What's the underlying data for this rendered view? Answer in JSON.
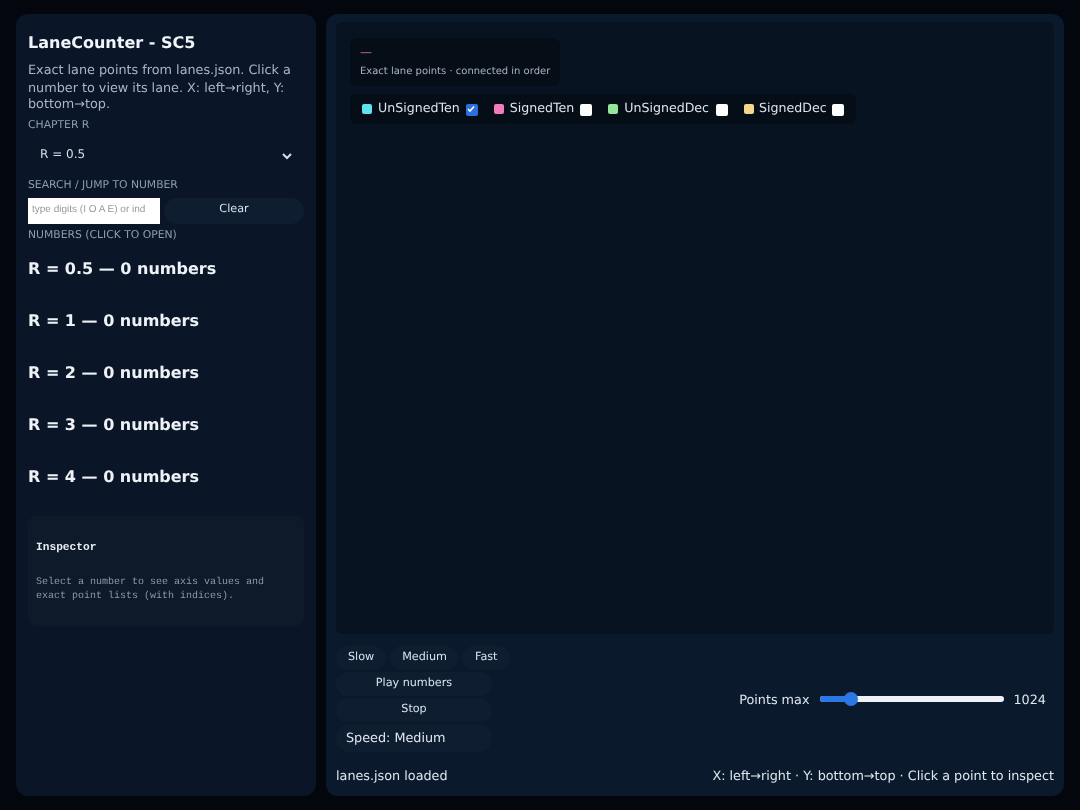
{
  "sidebar": {
    "title": "LaneCounter - SC5",
    "description": "Exact lane points from lanes.json. Click a number to view its lane. X: left→right, Y: bottom→top.",
    "chapter_label": "CHAPTER R",
    "chapter_value": "R = 0.5",
    "search_label": "SEARCH / JUMP TO NUMBER",
    "search_placeholder": "type digits (I O A E) or ind",
    "clear_button": "Clear",
    "numbers_label": "NUMBERS (CLICK TO OPEN)",
    "groups": [
      "R = 0.5 — 0 numbers",
      "R = 1 — 0 numbers",
      "R = 2 — 0 numbers",
      "R = 3 — 0 numbers",
      "R = 4 — 0 numbers"
    ],
    "inspector": {
      "title": "Inspector",
      "text": "Select a number to see axis values and exact point lists (with indices)."
    }
  },
  "chart": {
    "title": "—",
    "subtitle": "Exact lane points · connected in order",
    "legend": [
      {
        "label": "UnSignedTen",
        "color": "#5fe3f0",
        "checked": true
      },
      {
        "label": "SignedTen",
        "color": "#f27bbd",
        "checked": false
      },
      {
        "label": "UnSignedDec",
        "color": "#93e69a",
        "checked": false
      },
      {
        "label": "SignedDec",
        "color": "#f3d58c",
        "checked": false
      }
    ]
  },
  "controls": {
    "speed_buttons": [
      "Slow",
      "Medium",
      "Fast"
    ],
    "play_button": "Play numbers",
    "stop_button": "Stop",
    "speed_status": "Speed: Medium",
    "points_label": "Points max",
    "points": {
      "level": 0.17
    },
    "points_value": "1024"
  },
  "status_bar": {
    "left": "lanes.json loaded",
    "right": "X: left→right · Y: bottom→top · Click a point to inspect"
  }
}
